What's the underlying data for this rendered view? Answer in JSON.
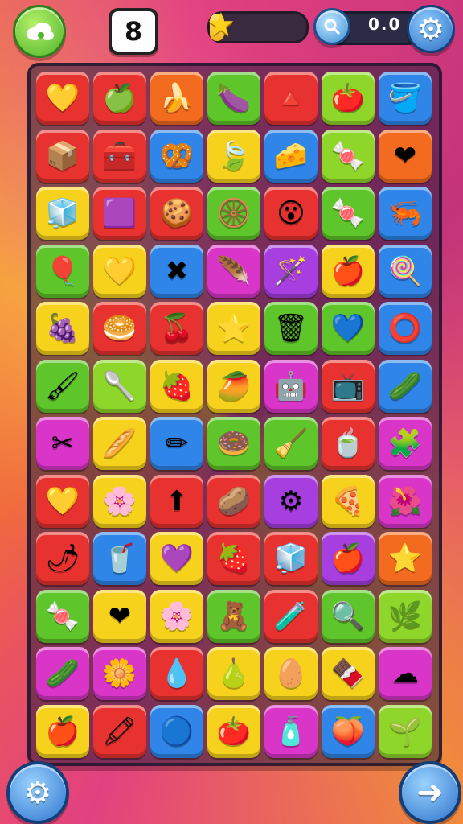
{
  "hud": {
    "level": "8",
    "star_progress": 0.15,
    "score": "0.0",
    "icons": {
      "cloud": "cloud-icon",
      "star": "star-icon",
      "search": "magnifier-icon",
      "settings": "gear-icon"
    }
  },
  "colors": {
    "red": "#e8322f",
    "orange": "#f26b1e",
    "yellow": "#f7d21c",
    "green": "#5ec52a",
    "lime": "#8fd62a",
    "blue": "#2f86e8",
    "purple": "#a63ee0",
    "magenta": "#d936c9"
  },
  "board": {
    "rows": [
      [
        {
          "c": "red",
          "g": "💛",
          "n": "heart"
        },
        {
          "c": "red",
          "g": "🍏",
          "n": "apple-slice"
        },
        {
          "c": "orange",
          "g": "🍌",
          "n": "banana"
        },
        {
          "c": "green",
          "g": "🍆",
          "n": "eggplant"
        },
        {
          "c": "red",
          "g": "🔺",
          "n": "triangle"
        },
        {
          "c": "lime",
          "g": "🍅",
          "n": "tomato"
        },
        {
          "c": "blue",
          "g": "🪣",
          "n": "bucket"
        }
      ],
      [
        {
          "c": "red",
          "g": "📦",
          "n": "box"
        },
        {
          "c": "red",
          "g": "🧰",
          "n": "crate"
        },
        {
          "c": "blue",
          "g": "🥨",
          "n": "pretzel"
        },
        {
          "c": "yellow",
          "g": "🍃",
          "n": "leaf"
        },
        {
          "c": "blue",
          "g": "🧀",
          "n": "cheese"
        },
        {
          "c": "lime",
          "g": "🍬",
          "n": "candy"
        },
        {
          "c": "orange",
          "g": "❤",
          "n": "heart"
        }
      ],
      [
        {
          "c": "yellow",
          "g": "🧊",
          "n": "cube"
        },
        {
          "c": "red",
          "g": "🟪",
          "n": "square"
        },
        {
          "c": "red",
          "g": "🍪",
          "n": "cookie"
        },
        {
          "c": "green",
          "g": "🛞",
          "n": "wheel"
        },
        {
          "c": "red",
          "g": "😮",
          "n": "face"
        },
        {
          "c": "green",
          "g": "🍬",
          "n": "candy"
        },
        {
          "c": "blue",
          "g": "🦐",
          "n": "shrimp"
        }
      ],
      [
        {
          "c": "green",
          "g": "🎈",
          "n": "balloon"
        },
        {
          "c": "yellow",
          "g": "💛",
          "n": "heart"
        },
        {
          "c": "blue",
          "g": "✖",
          "n": "cross"
        },
        {
          "c": "magenta",
          "g": "🪶",
          "n": "feather"
        },
        {
          "c": "purple",
          "g": "🪄",
          "n": "wand"
        },
        {
          "c": "yellow",
          "g": "🍎",
          "n": "apple"
        },
        {
          "c": "blue",
          "g": "🍭",
          "n": "lollipop"
        }
      ],
      [
        {
          "c": "yellow",
          "g": "🍇",
          "n": "grape"
        },
        {
          "c": "red",
          "g": "🥯",
          "n": "donut"
        },
        {
          "c": "red",
          "g": "🍒",
          "n": "cherry"
        },
        {
          "c": "yellow",
          "g": "⭐",
          "n": "star"
        },
        {
          "c": "green",
          "g": "🗑",
          "n": "bin"
        },
        {
          "c": "green",
          "g": "💙",
          "n": "heart"
        },
        {
          "c": "blue",
          "g": "⭕",
          "n": "ring"
        }
      ],
      [
        {
          "c": "green",
          "g": "🖌",
          "n": "brush"
        },
        {
          "c": "lime",
          "g": "🥄",
          "n": "spoon"
        },
        {
          "c": "yellow",
          "g": "🍓",
          "n": "strawberry"
        },
        {
          "c": "yellow",
          "g": "🥭",
          "n": "mango"
        },
        {
          "c": "magenta",
          "g": "🤖",
          "n": "robot"
        },
        {
          "c": "red",
          "g": "📺",
          "n": "tv"
        },
        {
          "c": "blue",
          "g": "🥒",
          "n": "cucumber"
        }
      ],
      [
        {
          "c": "magenta",
          "g": "✂",
          "n": "scissors"
        },
        {
          "c": "yellow",
          "g": "🥖",
          "n": "bread"
        },
        {
          "c": "blue",
          "g": "✏",
          "n": "pencil"
        },
        {
          "c": "green",
          "g": "🍩",
          "n": "donut"
        },
        {
          "c": "green",
          "g": "🧹",
          "n": "broom"
        },
        {
          "c": "red",
          "g": "🍵",
          "n": "cup"
        },
        {
          "c": "magenta",
          "g": "🧩",
          "n": "puzzle"
        }
      ],
      [
        {
          "c": "red",
          "g": "💛",
          "n": "heart"
        },
        {
          "c": "yellow",
          "g": "🌸",
          "n": "flower"
        },
        {
          "c": "red",
          "g": "⬆",
          "n": "arrow"
        },
        {
          "c": "red",
          "g": "🥔",
          "n": "potato"
        },
        {
          "c": "purple",
          "g": "⚙",
          "n": "gear"
        },
        {
          "c": "yellow",
          "g": "🍕",
          "n": "pizza"
        },
        {
          "c": "magenta",
          "g": "🌺",
          "n": "flower"
        }
      ],
      [
        {
          "c": "red",
          "g": "🌶",
          "n": "pepper"
        },
        {
          "c": "blue",
          "g": "🥤",
          "n": "cup"
        },
        {
          "c": "yellow",
          "g": "💜",
          "n": "heart"
        },
        {
          "c": "red",
          "g": "🍓",
          "n": "strawberry"
        },
        {
          "c": "red",
          "g": "🧊",
          "n": "ice"
        },
        {
          "c": "purple",
          "g": "🍎",
          "n": "apple"
        },
        {
          "c": "orange",
          "g": "⭐",
          "n": "star"
        }
      ],
      [
        {
          "c": "green",
          "g": "🍬",
          "n": "candy"
        },
        {
          "c": "yellow",
          "g": "❤",
          "n": "heart"
        },
        {
          "c": "yellow",
          "g": "🌸",
          "n": "flower"
        },
        {
          "c": "green",
          "g": "🧸",
          "n": "toy"
        },
        {
          "c": "red",
          "g": "🧪",
          "n": "potion"
        },
        {
          "c": "green",
          "g": "🔍",
          "n": "magnifier"
        },
        {
          "c": "lime",
          "g": "🌿",
          "n": "leaf"
        }
      ],
      [
        {
          "c": "magenta",
          "g": "🥒",
          "n": "cucumber"
        },
        {
          "c": "magenta",
          "g": "🌼",
          "n": "flower"
        },
        {
          "c": "red",
          "g": "💧",
          "n": "drop"
        },
        {
          "c": "yellow",
          "g": "🍐",
          "n": "pear"
        },
        {
          "c": "yellow",
          "g": "🥚",
          "n": "egg"
        },
        {
          "c": "yellow",
          "g": "🍫",
          "n": "chocolate"
        },
        {
          "c": "magenta",
          "g": "☁",
          "n": "cloud"
        }
      ],
      [
        {
          "c": "yellow",
          "g": "🍎",
          "n": "apple"
        },
        {
          "c": "red",
          "g": "🖍",
          "n": "crayon"
        },
        {
          "c": "blue",
          "g": "🔵",
          "n": "ring"
        },
        {
          "c": "yellow",
          "g": "🍅",
          "n": "tomato"
        },
        {
          "c": "magenta",
          "g": "🧴",
          "n": "bottle"
        },
        {
          "c": "blue",
          "g": "🍑",
          "n": "peach"
        },
        {
          "c": "lime",
          "g": "🌱",
          "n": "sprout"
        }
      ]
    ]
  }
}
